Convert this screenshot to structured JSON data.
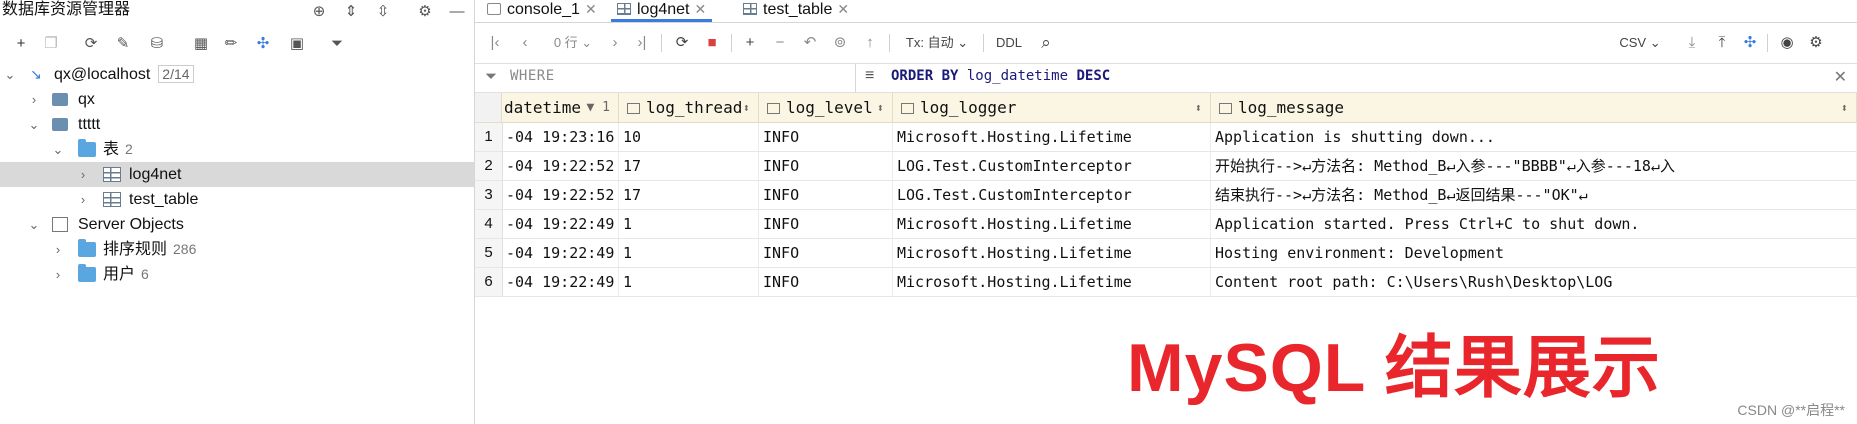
{
  "left_panel": {
    "title": "数据库资源管理器",
    "tree": [
      {
        "label": "qx@localhost",
        "badge": "2/14"
      },
      {
        "label": "qx"
      },
      {
        "label": "ttttt"
      },
      {
        "label": "表",
        "count": "2"
      },
      {
        "label": "log4net"
      },
      {
        "label": "test_table"
      },
      {
        "label": "Server Objects"
      },
      {
        "label": "排序规则",
        "count": "286"
      },
      {
        "label": "用户",
        "count": "6"
      }
    ]
  },
  "tabs": [
    {
      "label": "console_1"
    },
    {
      "label": "log4net"
    },
    {
      "label": "test_table"
    }
  ],
  "toolbar": {
    "rows": "0 行",
    "tx": "Tx: 自动",
    "ddl": "DDL",
    "export": "CSV"
  },
  "filter": {
    "where": "WHERE",
    "order_kw": "ORDER BY",
    "order_col": "log_datetime",
    "order_dir": "DESC"
  },
  "grid": {
    "columns": [
      {
        "label": "datetime",
        "sort": "▼ 1"
      },
      {
        "label": "log_thread",
        "sort": "⬍"
      },
      {
        "label": "log_level",
        "sort": "⬍"
      },
      {
        "label": "log_logger",
        "sort": "⬍"
      },
      {
        "label": "log_message",
        "sort": "⬍"
      }
    ],
    "rows": [
      {
        "n": "1",
        "c": [
          "-04 19:23:16",
          "10",
          "INFO",
          "Microsoft.Hosting.Lifetime",
          "Application is shutting down..."
        ]
      },
      {
        "n": "2",
        "c": [
          "-04 19:22:52",
          "17",
          "INFO",
          "LOG.Test.CustomInterceptor",
          "开始执行-->↵方法名: Method_B↵入参---\"BBBB\"↵入参---18↵入"
        ]
      },
      {
        "n": "3",
        "c": [
          "-04 19:22:52",
          "17",
          "INFO",
          "LOG.Test.CustomInterceptor",
          "结束执行-->↵方法名: Method_B↵返回结果---\"OK\"↵"
        ]
      },
      {
        "n": "4",
        "c": [
          "-04 19:22:49",
          "1",
          "INFO",
          "Microsoft.Hosting.Lifetime",
          "Application started. Press Ctrl+C to shut down."
        ]
      },
      {
        "n": "5",
        "c": [
          "-04 19:22:49",
          "1",
          "INFO",
          "Microsoft.Hosting.Lifetime",
          "Hosting environment: Development"
        ]
      },
      {
        "n": "6",
        "c": [
          "-04 19:22:49",
          "1",
          "INFO",
          "Microsoft.Hosting.Lifetime",
          "Content root path: C:\\Users\\Rush\\Desktop\\LOG"
        ]
      }
    ]
  },
  "overlay_text": "MySQL 结果展示",
  "watermark": "CSDN @**启程**"
}
